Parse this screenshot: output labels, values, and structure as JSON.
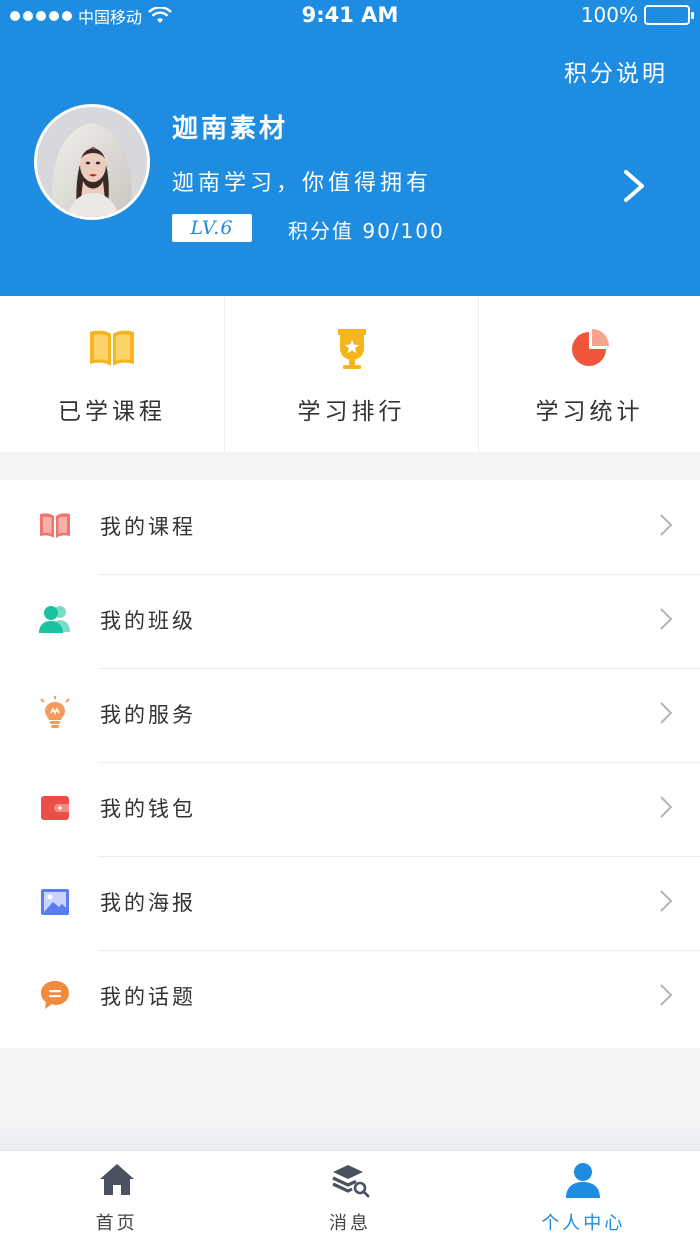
{
  "status_bar": {
    "carrier": "中国移动",
    "time": "9:41 AM",
    "battery": "100%"
  },
  "header": {
    "points_link": "积分说明",
    "user_name": "迦南素材",
    "slogan": "迦南学习，你值得拥有",
    "level": "LV.6",
    "points": "积分值 90/100"
  },
  "quick": [
    {
      "label": "已学课程",
      "icon": "open-book-icon",
      "color": "#f5b51c"
    },
    {
      "label": "学习排行",
      "icon": "trophy-icon",
      "color": "#f5b51c"
    },
    {
      "label": "学习统计",
      "icon": "pie-chart-icon",
      "color": "#f0563a"
    }
  ],
  "menu": [
    {
      "label": "我的课程",
      "icon": "book-icon",
      "color": "#f0756e"
    },
    {
      "label": "我的班级",
      "icon": "users-icon",
      "color": "#19c2a0"
    },
    {
      "label": "我的服务",
      "icon": "lightbulb-icon",
      "color": "#f59b5d"
    },
    {
      "label": "我的钱包",
      "icon": "wallet-icon",
      "color": "#e94f45"
    },
    {
      "label": "我的海报",
      "icon": "image-icon",
      "color": "#5b7cf0"
    },
    {
      "label": "我的话题",
      "icon": "chat-icon",
      "color": "#f08a3c"
    }
  ],
  "tabs": [
    {
      "label": "首页",
      "icon": "home-icon",
      "active": false
    },
    {
      "label": "消息",
      "icon": "layers-search-icon",
      "active": false
    },
    {
      "label": "个人中心",
      "icon": "person-icon",
      "active": true
    }
  ],
  "colors": {
    "brand": "#1e8ce0",
    "background": "#f4f4f5"
  }
}
